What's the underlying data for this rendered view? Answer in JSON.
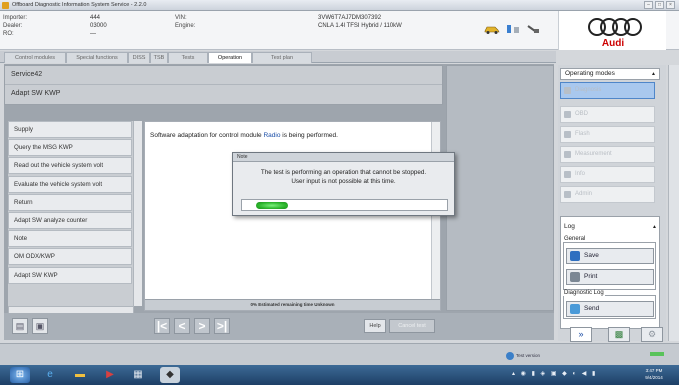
{
  "window": {
    "title": "Offboard Diagnostic Information System Service - 2.2.0",
    "controls": [
      "–",
      "□",
      "×"
    ]
  },
  "header": {
    "labels": [
      "Importer:",
      "Dealer:",
      "RO:"
    ],
    "values": [
      "444",
      "03000",
      "—"
    ],
    "vin_label": "VIN:",
    "vin_value": "3VW6T7AJ7DM307392",
    "engine_label": "Engine:",
    "engine_value": "CNLA 1.4l TFSI Hybrid / 110kW",
    "brand": "Audi"
  },
  "tabs": [
    {
      "label": "Control modules",
      "active": false
    },
    {
      "label": "Special functions",
      "active": false
    },
    {
      "label": "DISS",
      "active": false
    },
    {
      "label": "TSB",
      "active": false
    },
    {
      "label": "Tests",
      "active": false
    },
    {
      "label": "Operation",
      "active": true
    },
    {
      "label": "Test plan",
      "active": false
    }
  ],
  "service": {
    "title": "Service42",
    "subtitle": "Adapt SW KWP"
  },
  "steps": [
    "Supply",
    "Query the MSG KWP",
    "Read out the vehicle system volt",
    "Evaluate the vehicle system volt",
    "Return",
    "Adapt SW analyze counter",
    "Note",
    "OM ODX/KWP",
    "Adapt SW KWP"
  ],
  "content": {
    "message_prefix": "Software adaptation for control module",
    "message_highlight": "Radio",
    "message_suffix": "is being performed.",
    "progress_text": "0% Estimated remaining time Unknown"
  },
  "dialog": {
    "title": "Note",
    "line1": "The test is performing an operation that cannot be stopped.",
    "line2": "User input is not possible at this time.",
    "progress": 0.15
  },
  "bottom": {
    "help": "Help",
    "cancel": "Cancel test",
    "nav": [
      "|<",
      "<",
      ">",
      ">|"
    ]
  },
  "operating_modes": {
    "title": "Operating modes",
    "items": [
      "Diagnosis",
      "OBD",
      "Flash",
      "Measurement",
      "Info",
      "Admin"
    ],
    "selected": 0
  },
  "log": {
    "title": "Log",
    "general_label": "General",
    "save": "Save",
    "print": "Print",
    "diag_label": "Diagnostic Log",
    "send": "Send"
  },
  "statusbar": {
    "test_version": "Test version"
  },
  "taskbar": {
    "time": "3:47 PM",
    "date": "9/4/2014"
  },
  "colors": {
    "accent": "#a9c8ee",
    "brand_red": "#cc0000",
    "progress_green": "#2cb52c"
  }
}
